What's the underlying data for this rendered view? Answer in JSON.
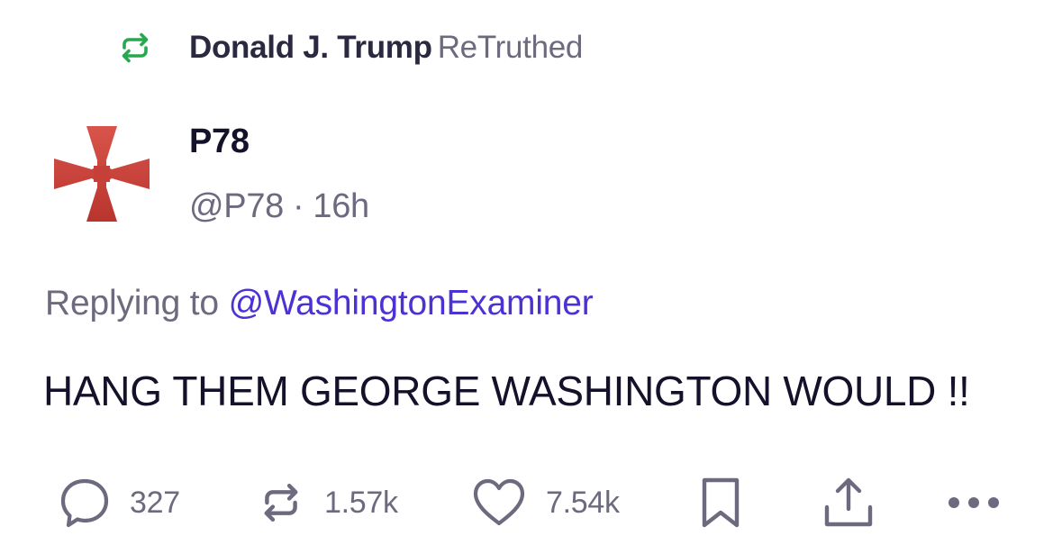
{
  "retruth": {
    "name": "Donald J. Trump",
    "label": "ReTruthed",
    "icon": "retruth-icon",
    "icon_color": "#27a84f"
  },
  "author": {
    "display_name": "P78",
    "handle": "@P78",
    "separator": "·",
    "time": "16h",
    "avatar": "red-cross-avatar",
    "avatar_color": "#c9413a"
  },
  "reply": {
    "prefix": "Replying to",
    "handle": "@WashingtonExaminer",
    "handle_color": "#4a32d4"
  },
  "post": {
    "text": "HANG THEM GEORGE WASHINGTON WOULD !!"
  },
  "actions": {
    "replies": "327",
    "retruths": "1.57k",
    "likes": "7.54k",
    "icon_color": "#6c6a7e"
  }
}
